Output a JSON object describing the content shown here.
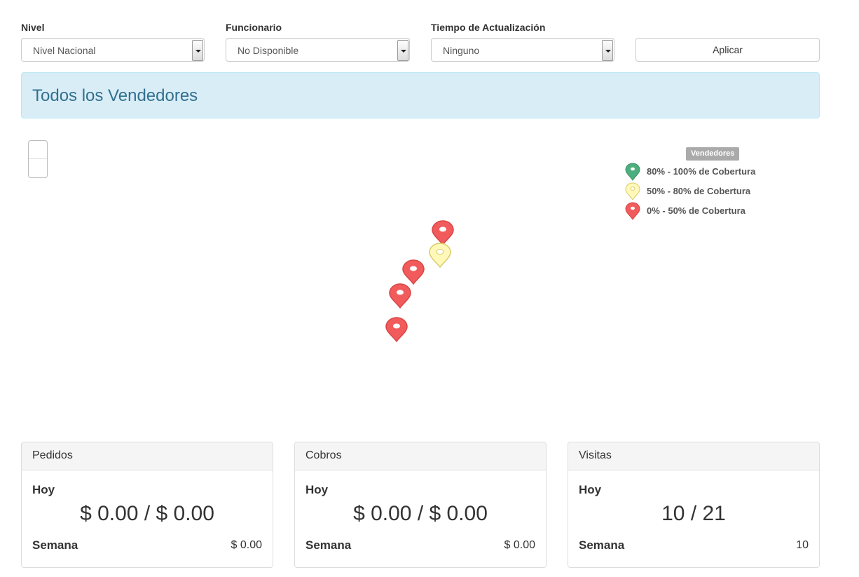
{
  "filters": {
    "nivel": {
      "label": "Nivel",
      "value": "Nivel Nacional"
    },
    "funcionario": {
      "label": "Funcionario",
      "value": "No Disponible"
    },
    "tiempo": {
      "label": "Tiempo de Actualización",
      "value": "Ninguno"
    },
    "apply_label": "Aplicar"
  },
  "banner": {
    "title": "Todos los Vendedores"
  },
  "map": {
    "legend": {
      "title": "Vendedores",
      "items": [
        {
          "label": "80% - 100% de Cobertura",
          "color": "#4caf7d",
          "icon": "map-pin-icon"
        },
        {
          "label": "50% - 80% de Cobertura",
          "color": "#fff8b8",
          "icon": "map-pin-icon"
        },
        {
          "label": "0% - 50% de Cobertura",
          "color": "#f25b5b",
          "icon": "map-pin-icon"
        }
      ]
    },
    "markers": [
      {
        "coverage": "0% - 50%",
        "color": "#f25b5b"
      },
      {
        "coverage": "50% - 80%",
        "color": "#fff8b8"
      },
      {
        "coverage": "0% - 50%",
        "color": "#f25b5b"
      },
      {
        "coverage": "0% - 50%",
        "color": "#f25b5b"
      },
      {
        "coverage": "0% - 50%",
        "color": "#f25b5b"
      }
    ]
  },
  "panels": [
    {
      "title": "Pedidos",
      "today_label": "Hoy",
      "today_value": "$ 0.00 / $ 0.00",
      "week_label": "Semana",
      "week_value": "$ 0.00"
    },
    {
      "title": "Cobros",
      "today_label": "Hoy",
      "today_value": "$ 0.00 / $ 0.00",
      "week_label": "Semana",
      "week_value": "$ 0.00"
    },
    {
      "title": "Visitas",
      "today_label": "Hoy",
      "today_value": "10 / 21",
      "week_label": "Semana",
      "week_value": "10"
    }
  ]
}
